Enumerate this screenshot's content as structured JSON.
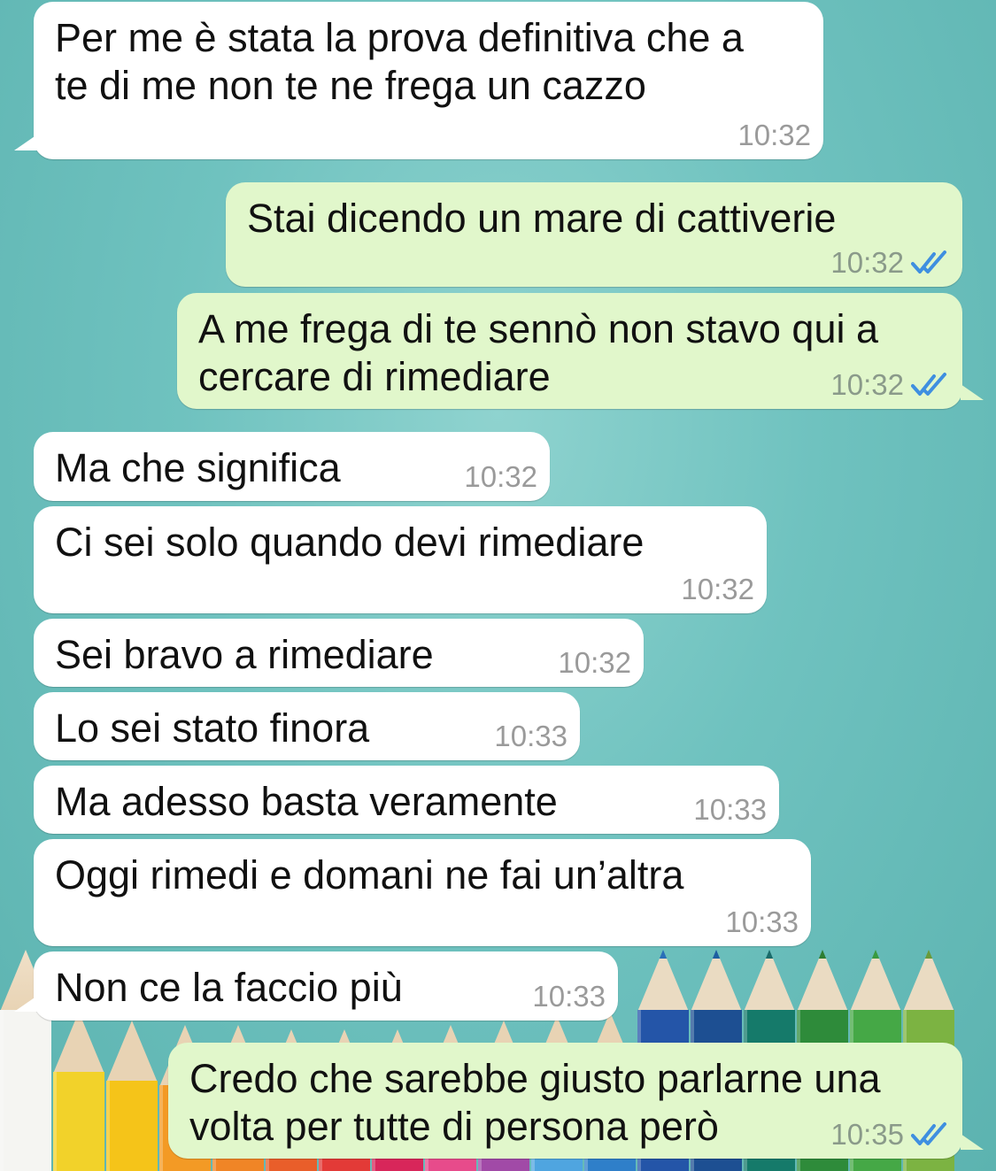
{
  "chat": {
    "messages": [
      {
        "dir": "in",
        "text": "Per me è stata la prova definitiva che a\nte di me non te ne frega un cazzo",
        "time": "10:32",
        "tail": true
      },
      {
        "dir": "out",
        "text": "Stai dicendo un mare di cattiverie",
        "time": "10:32",
        "read": true,
        "tail": false
      },
      {
        "dir": "out",
        "text": "A me frega di te sennò non stavo qui a\ncercare di rimediare",
        "time": "10:32",
        "read": true,
        "tail": true
      },
      {
        "dir": "in",
        "text": "Ma che significa",
        "time": "10:32",
        "tail": false
      },
      {
        "dir": "in",
        "text": "Ci sei solo quando devi rimediare",
        "time": "10:32",
        "tail": false
      },
      {
        "dir": "in",
        "text": "Sei bravo a rimediare",
        "time": "10:32",
        "tail": false
      },
      {
        "dir": "in",
        "text": "Lo sei stato finora",
        "time": "10:33",
        "tail": false
      },
      {
        "dir": "in",
        "text": "Ma adesso basta veramente",
        "time": "10:33",
        "tail": false
      },
      {
        "dir": "in",
        "text": "Oggi rimedi e domani ne fai un’altra",
        "time": "10:33",
        "tail": false
      },
      {
        "dir": "in",
        "text": "Non ce la faccio più",
        "time": "10:33",
        "tail": true
      },
      {
        "dir": "out",
        "text": "Credo che sarebbe giusto parlarne una\nvolta per tutte di persona però",
        "time": "10:35",
        "read": true,
        "tail": true
      }
    ]
  },
  "colors": {
    "incoming_bubble": "#ffffff",
    "outgoing_bubble": "#e1f7cb",
    "read_ticks": "#3f8fe0",
    "background": "#6fc2bf"
  },
  "icons": {
    "read_receipt": "double-check-icon"
  }
}
